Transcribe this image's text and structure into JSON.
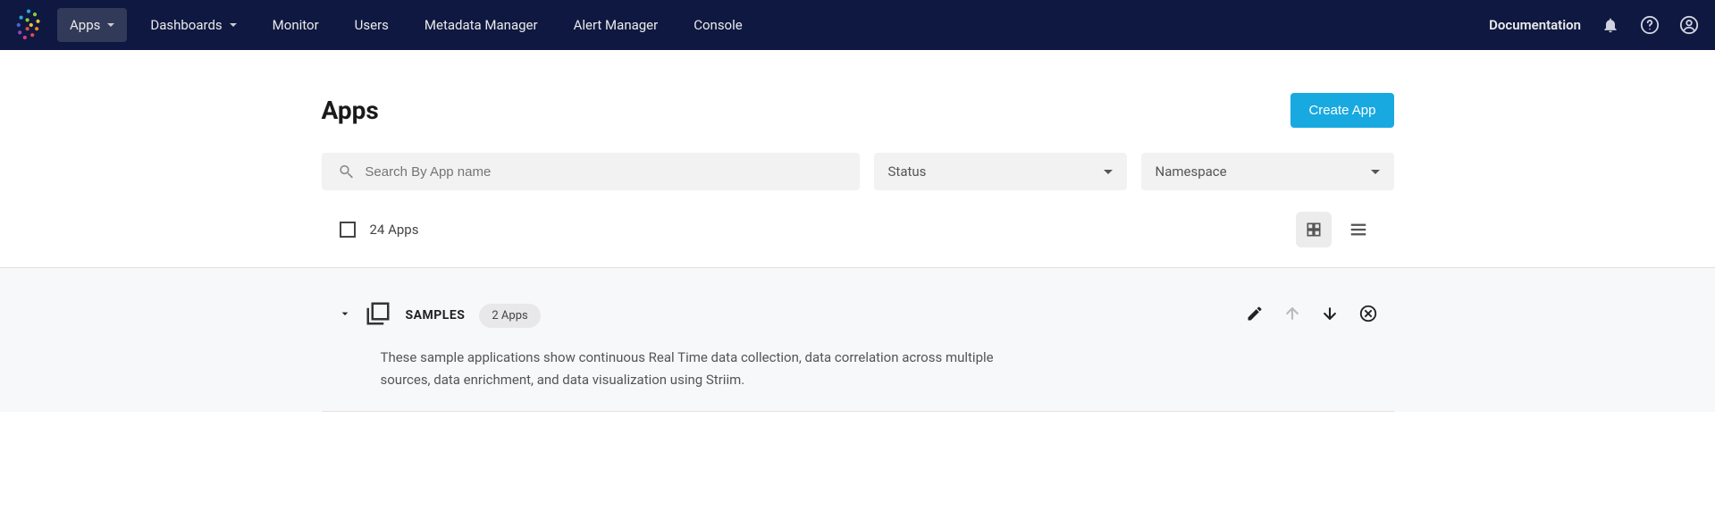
{
  "nav": {
    "items": [
      {
        "label": "Apps",
        "active": true,
        "hasChevron": true
      },
      {
        "label": "Dashboards",
        "active": false,
        "hasChevron": true
      },
      {
        "label": "Monitor",
        "active": false,
        "hasChevron": false
      },
      {
        "label": "Users",
        "active": false,
        "hasChevron": false
      },
      {
        "label": "Metadata Manager",
        "active": false,
        "hasChevron": false
      },
      {
        "label": "Alert Manager",
        "active": false,
        "hasChevron": false
      },
      {
        "label": "Console",
        "active": false,
        "hasChevron": false
      }
    ],
    "documentation": "Documentation"
  },
  "page": {
    "title": "Apps",
    "create_button": "Create App"
  },
  "filters": {
    "search_placeholder": "Search By App name",
    "status_label": "Status",
    "namespace_label": "Namespace"
  },
  "toolbar": {
    "count_label": "24 Apps"
  },
  "group": {
    "title": "SAMPLES",
    "badge": "2 Apps",
    "description": "These sample applications show continuous Real Time data collection, data correlation across multiple sources, data enrichment, and data visualization using Striim."
  },
  "colors": {
    "navbar_bg": "#0f1840",
    "accent": "#18a9e0"
  }
}
